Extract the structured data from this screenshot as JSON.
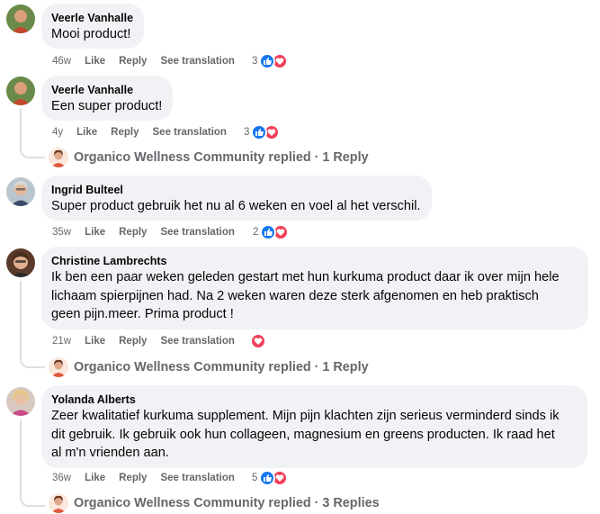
{
  "comments": [
    {
      "author": "Veerle Vanhalle",
      "text": "Mooi product!",
      "time": "46w",
      "like_label": "Like",
      "reply_label": "Reply",
      "translate_label": "See translation",
      "reaction_count": "3",
      "reactions": [
        "like-icon",
        "love-icon"
      ]
    },
    {
      "author": "Veerle Vanhalle",
      "text": "Een super product!",
      "time": "4y",
      "like_label": "Like",
      "reply_label": "Reply",
      "translate_label": "See translation",
      "reaction_count": "3",
      "reactions": [
        "like-icon",
        "love-icon"
      ],
      "replies_summary": "Organico Wellness Community replied · 1 Reply"
    },
    {
      "author": "Ingrid Bulteel",
      "text": "Super product gebruik het nu al 6 weken en voel al het verschil.",
      "time": "35w",
      "like_label": "Like",
      "reply_label": "Reply",
      "translate_label": "See translation",
      "reaction_count": "2",
      "reactions": [
        "like-icon",
        "love-icon"
      ]
    },
    {
      "author": "Christine Lambrechts",
      "text": "Ik ben een paar weken geleden gestart met hun kurkuma product daar ik over mijn hele\nlichaam spierpijnen had. Na 2 weken waren deze sterk afgenomen en heb praktisch\ngeen pijn.meer. Prima product !",
      "time": "21w",
      "like_label": "Like",
      "reply_label": "Reply",
      "translate_label": "See translation",
      "reaction_count": "",
      "reactions": [
        "love-icon"
      ],
      "replies_summary": "Organico Wellness Community replied · 1 Reply"
    },
    {
      "author": "Yolanda Alberts",
      "text": "Zeer kwalitatief kurkuma supplement. Mijn pijn klachten zijn serieus verminderd sinds ik\ndit gebruik. Ik gebruik ook hun collageen, magnesium en greens producten. Ik raad het\nal m'n vrienden aan.",
      "time": "36w",
      "like_label": "Like",
      "reply_label": "Reply",
      "translate_label": "See translation",
      "reaction_count": "5",
      "reactions": [
        "like-icon",
        "love-icon"
      ],
      "replies_summary": "Organico Wellness Community replied · 3 Replies"
    }
  ],
  "colors": {
    "bubble": "#f0f2f5",
    "meta_text": "#65676b",
    "like_blue": "#1877f2",
    "love_red": "#f33e58"
  }
}
